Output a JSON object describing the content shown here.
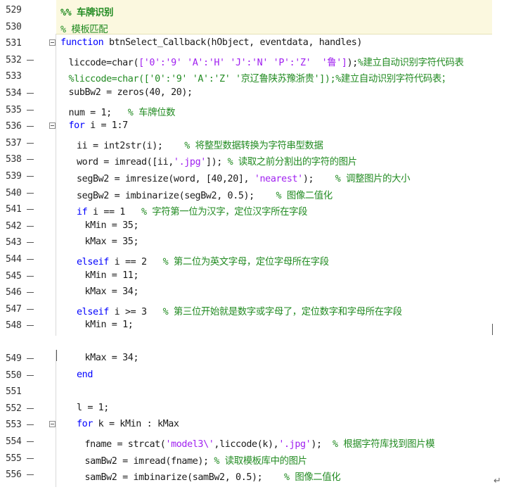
{
  "top_lines": [
    {
      "num": "529",
      "dash": false,
      "fold": false,
      "indent": 0,
      "segs": [
        {
          "t": "%% 车牌识别",
          "c": "cellhd"
        }
      ]
    },
    {
      "num": "530",
      "dash": false,
      "fold": false,
      "indent": 0,
      "segs": [
        {
          "t": "% 模板匹配",
          "c": "cm"
        }
      ]
    },
    {
      "num": "531",
      "dash": false,
      "fold": true,
      "indent": 0,
      "segs": [
        {
          "t": "function",
          "c": "kw"
        },
        {
          "t": " btnSelect_Callback(hObject, eventdata, handles)",
          "c": ""
        }
      ]
    },
    {
      "num": "532",
      "dash": true,
      "fold": false,
      "indent": 1,
      "segs": [
        {
          "t": "liccode=char(",
          "c": ""
        },
        {
          "t": "['0':'9' 'A':'H' 'J':'N' 'P':'Z'  '鲁']",
          "c": "str"
        },
        {
          "t": ");",
          "c": ""
        },
        {
          "t": "%建立自动识别字符代码表",
          "c": "cm"
        }
      ]
    },
    {
      "num": "533",
      "dash": false,
      "fold": false,
      "indent": 1,
      "segs": [
        {
          "t": "%liccode=char(['0':'9' 'A':'Z' '京辽鲁陕苏豫浙贵']);%建立自动识别字符代码表；",
          "c": "cm"
        }
      ]
    },
    {
      "num": "534",
      "dash": true,
      "fold": false,
      "indent": 1,
      "segs": [
        {
          "t": "subBw2 = zeros(40, 20);",
          "c": ""
        }
      ]
    },
    {
      "num": "535",
      "dash": true,
      "fold": false,
      "indent": 1,
      "segs": [
        {
          "t": "num = 1;   ",
          "c": ""
        },
        {
          "t": "% 车牌位数",
          "c": "cm"
        }
      ]
    },
    {
      "num": "536",
      "dash": true,
      "fold": true,
      "indent": 1,
      "segs": [
        {
          "t": "for",
          "c": "kw"
        },
        {
          "t": " i = 1:7",
          "c": ""
        }
      ]
    },
    {
      "num": "537",
      "dash": true,
      "fold": false,
      "indent": 2,
      "segs": [
        {
          "t": "ii = int2str(i);    ",
          "c": ""
        },
        {
          "t": "% 将整型数据转换为字符串型数据",
          "c": "cm"
        }
      ]
    },
    {
      "num": "538",
      "dash": true,
      "fold": false,
      "indent": 2,
      "segs": [
        {
          "t": "word = imread([ii,",
          "c": ""
        },
        {
          "t": "'.jpg'",
          "c": "str"
        },
        {
          "t": "]); ",
          "c": ""
        },
        {
          "t": "% 读取之前分割出的字符的图片",
          "c": "cm"
        }
      ]
    },
    {
      "num": "539",
      "dash": true,
      "fold": false,
      "indent": 2,
      "segs": [
        {
          "t": "segBw2 = imresize(word, [40,20], ",
          "c": ""
        },
        {
          "t": "'nearest'",
          "c": "str"
        },
        {
          "t": ");    ",
          "c": ""
        },
        {
          "t": "% 调整图片的大小",
          "c": "cm"
        }
      ]
    },
    {
      "num": "540",
      "dash": true,
      "fold": false,
      "indent": 2,
      "segs": [
        {
          "t": "segBw2 = imbinarize(segBw2, 0.5);    ",
          "c": ""
        },
        {
          "t": "% 图像二值化",
          "c": "cm"
        }
      ]
    },
    {
      "num": "541",
      "dash": true,
      "fold": false,
      "indent": 2,
      "segs": [
        {
          "t": "if",
          "c": "kw"
        },
        {
          "t": " i == 1   ",
          "c": ""
        },
        {
          "t": "% 字符第一位为汉字，定位汉字所在字段",
          "c": "cm"
        }
      ]
    },
    {
      "num": "542",
      "dash": true,
      "fold": false,
      "indent": 3,
      "segs": [
        {
          "t": "kMin = 35;",
          "c": ""
        }
      ]
    },
    {
      "num": "543",
      "dash": true,
      "fold": false,
      "indent": 3,
      "segs": [
        {
          "t": "kMax = 35;",
          "c": ""
        }
      ]
    },
    {
      "num": "544",
      "dash": true,
      "fold": false,
      "indent": 2,
      "segs": [
        {
          "t": "elseif",
          "c": "kw"
        },
        {
          "t": " i == 2   ",
          "c": ""
        },
        {
          "t": "% 第二位为英文字母，定位字母所在字段",
          "c": "cm"
        }
      ]
    },
    {
      "num": "545",
      "dash": true,
      "fold": false,
      "indent": 3,
      "segs": [
        {
          "t": "kMin = 11;",
          "c": ""
        }
      ]
    },
    {
      "num": "546",
      "dash": true,
      "fold": false,
      "indent": 3,
      "segs": [
        {
          "t": "kMax = 34;",
          "c": ""
        }
      ]
    },
    {
      "num": "547",
      "dash": true,
      "fold": false,
      "indent": 2,
      "segs": [
        {
          "t": "elseif",
          "c": "kw"
        },
        {
          "t": " i >= 3   ",
          "c": ""
        },
        {
          "t": "% 第三位开始就是数字或字母了，定位数字和字母所在字段",
          "c": "cm"
        }
      ]
    },
    {
      "num": "548",
      "dash": true,
      "fold": false,
      "indent": 3,
      "segs": [
        {
          "t": "kMin = 1;",
          "c": ""
        }
      ]
    }
  ],
  "bottom_lines": [
    {
      "num": "549",
      "dash": true,
      "fold": false,
      "indent": 3,
      "segs": [
        {
          "t": "kMax = 34;",
          "c": ""
        }
      ]
    },
    {
      "num": "550",
      "dash": true,
      "fold": false,
      "indent": 2,
      "segs": [
        {
          "t": "end",
          "c": "kw"
        }
      ]
    },
    {
      "num": "551",
      "dash": false,
      "fold": false,
      "indent": 0,
      "segs": []
    },
    {
      "num": "552",
      "dash": true,
      "fold": false,
      "indent": 2,
      "segs": [
        {
          "t": "l = 1;",
          "c": ""
        }
      ]
    },
    {
      "num": "553",
      "dash": true,
      "fold": true,
      "indent": 2,
      "segs": [
        {
          "t": "for",
          "c": "kw"
        },
        {
          "t": " k = kMin : kMax",
          "c": ""
        }
      ]
    },
    {
      "num": "554",
      "dash": true,
      "fold": false,
      "indent": 3,
      "segs": [
        {
          "t": "fname = strcat(",
          "c": ""
        },
        {
          "t": "'model3\\'",
          "c": "str"
        },
        {
          "t": ",liccode(k),",
          "c": ""
        },
        {
          "t": "'.jpg'",
          "c": "str"
        },
        {
          "t": ");  ",
          "c": ""
        },
        {
          "t": "% 根据字符库找到图片模",
          "c": "cm"
        }
      ]
    },
    {
      "num": "555",
      "dash": true,
      "fold": false,
      "indent": 3,
      "segs": [
        {
          "t": "samBw2 = imread(fname); ",
          "c": ""
        },
        {
          "t": "% 读取模板库中的图片",
          "c": "cm"
        }
      ]
    },
    {
      "num": "556",
      "dash": true,
      "fold": false,
      "indent": 3,
      "segs": [
        {
          "t": "samBw2 = imbinarize(samBw2, 0.5);    ",
          "c": ""
        },
        {
          "t": "% 图像二值化",
          "c": "cm"
        }
      ]
    }
  ],
  "return_glyph": "↵"
}
